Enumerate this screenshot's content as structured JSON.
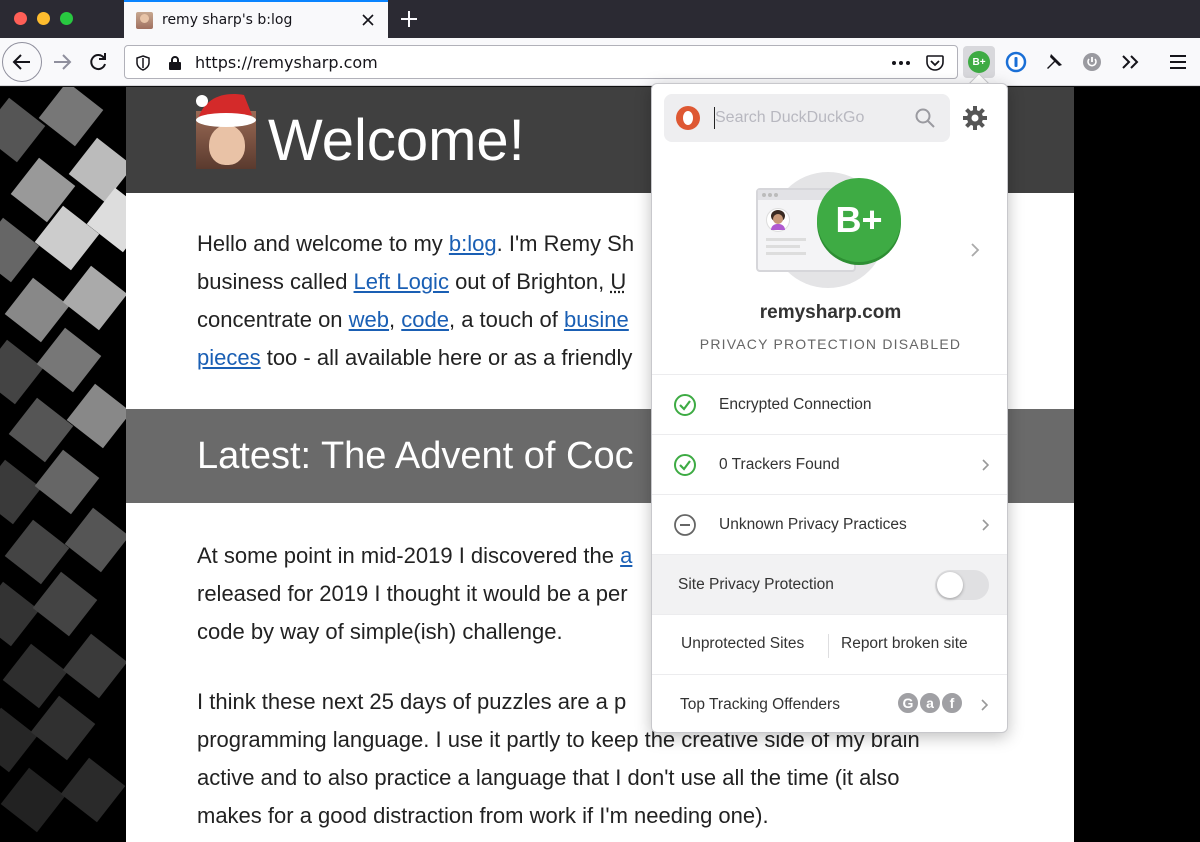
{
  "browser": {
    "tab": {
      "title": "remy sharp's b:log"
    },
    "url": "https://remysharp.com",
    "extension_badge": "B+"
  },
  "page": {
    "welcome_title": "Welcome!",
    "intro": {
      "l1_a": "Hello and welcome to my ",
      "l1_link": "b:log",
      "l1_b": ". I'm Remy Sh",
      "l2_a": "business called ",
      "l2_link": "Left Logic",
      "l2_b": " out of Brighton, ",
      "l2_link2": "U",
      "l3_a": "concentrate on ",
      "l3_link1": "web",
      "l3_b": ", ",
      "l3_link2": "code",
      "l3_c": ", a touch of ",
      "l3_link3": "busine",
      "l4_link": "pieces",
      "l4_a": " too - all available here or as a friendly"
    },
    "latest_title": "Latest: The Advent of Coc",
    "body": {
      "p1_l1_a": "At some point in mid-2019 I discovered the ",
      "p1_l1_link": "a",
      "p1_l2": "released for 2019 I thought it would be a per",
      "p1_l3": "code by way of simple(ish) challenge.",
      "p2_l1": "I think these next 25 days of puzzles are a p",
      "p2_l2": "programming language. I use it partly to keep the creative side of my brain",
      "p2_l3": "active and to also practice a language that I don't use all the time (it also",
      "p2_l4": "makes for a good distraction from work if I'm needing one)."
    }
  },
  "popup": {
    "search_placeholder": "Search DuckDuckGo",
    "grade": "B+",
    "site_domain": "remysharp.com",
    "protection_status": "PRIVACY PROTECTION DISABLED",
    "rows": {
      "encrypted": "Encrypted Connection",
      "trackers": "0 Trackers Found",
      "privacy_practices": "Unknown Privacy Practices",
      "site_protection": "Site Privacy Protection",
      "top_offenders": "Top Tracking Offenders"
    },
    "site_protection_on": false,
    "unprotected_sites": "Unprotected Sites",
    "report_broken": "Report broken site",
    "offenders": [
      "G",
      "a",
      "f"
    ],
    "colors": {
      "grade_green": "#3eab44",
      "check_green": "#3eab44",
      "ddg_orange": "#de5833"
    }
  }
}
